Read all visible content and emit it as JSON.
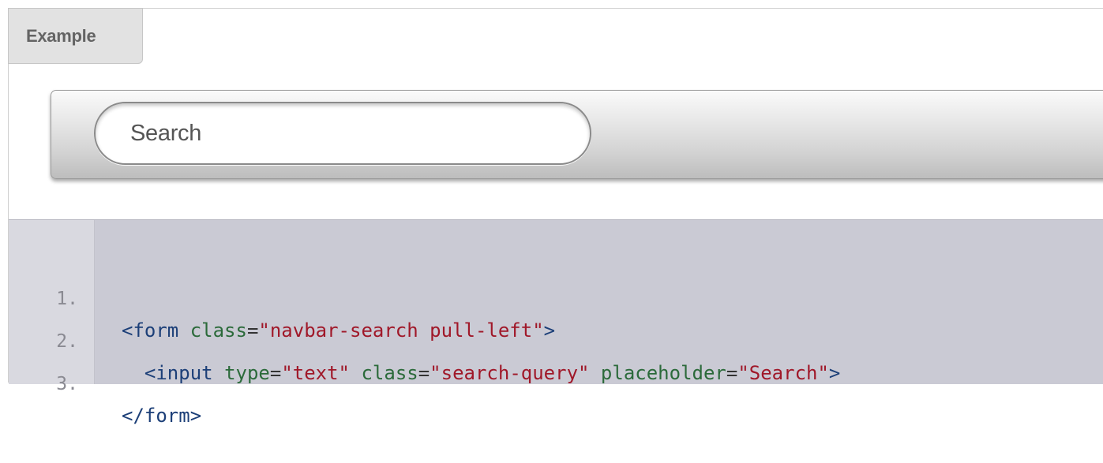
{
  "example_tab": {
    "label": "Example"
  },
  "preview": {
    "search": {
      "placeholder": "Search"
    }
  },
  "code": {
    "lines": [
      {
        "number": "1.",
        "tokens": [
          "<form",
          " ",
          "class",
          "=",
          "\"navbar-search pull-left\"",
          ">"
        ]
      },
      {
        "number": "2.",
        "tokens": [
          "  ",
          "<input",
          " ",
          "type",
          "=",
          "\"text\"",
          " ",
          "class",
          "=",
          "\"search-query\"",
          " ",
          "placeholder",
          "=",
          "\"Search\"",
          ">"
        ]
      },
      {
        "number": "3.",
        "tokens": [
          "</form>"
        ]
      }
    ]
  },
  "colors": {
    "tag": "#1c3f78",
    "attribute": "#2b6a3a",
    "value": "#a01829",
    "code_background": "#cacad4"
  }
}
